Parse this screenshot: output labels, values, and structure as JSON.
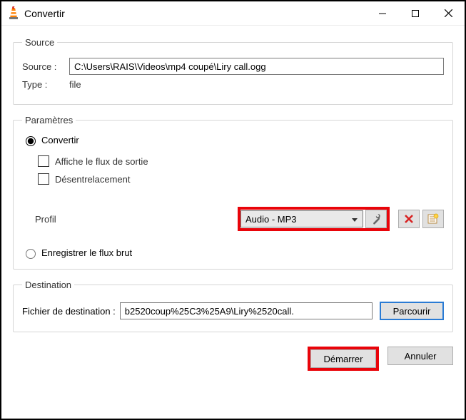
{
  "window": {
    "title": "Convertir"
  },
  "source": {
    "legend": "Source",
    "source_label": "Source :",
    "source_value": "C:\\Users\\RAIS\\Videos\\mp4 coupé\\Liry call.ogg",
    "type_label": "Type :",
    "type_value": "file"
  },
  "settings": {
    "legend": "Paramètres",
    "convert_label": "Convertir",
    "show_output_label": "Affiche le flux de sortie",
    "deinterlace_label": "Désentrelacement",
    "profile_label": "Profil",
    "profile_value": "Audio - MP3",
    "dump_raw_label": "Enregistrer le flux brut"
  },
  "destination": {
    "legend": "Destination",
    "dest_label": "Fichier de destination :",
    "dest_value": "b2520coup%25C3%25A9\\Liry%2520call.",
    "browse_label": "Parcourir"
  },
  "footer": {
    "start_label": "Démarrer",
    "cancel_label": "Annuler"
  }
}
